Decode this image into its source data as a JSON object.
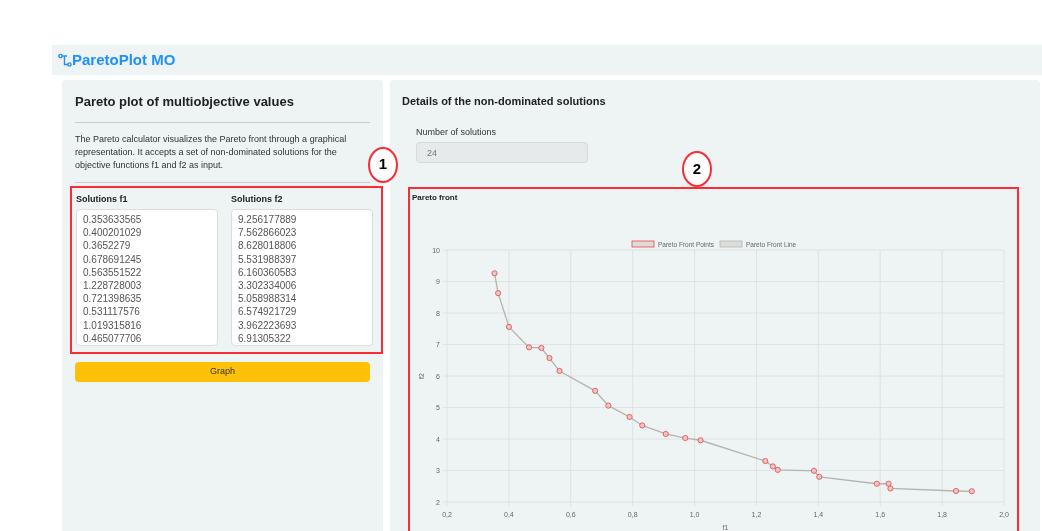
{
  "app": {
    "title": "ParetoPlot MO"
  },
  "left_panel": {
    "title": "Pareto plot of multiobjective values",
    "description": "The Pareto calculator visualizes the Pareto front through a graphical representation. It accepts a set of non-dominated solutions for the objective functions f1 and f2 as input.",
    "inputs": [
      {
        "label": "Solutions f1",
        "value": "0.353633565\n0.400201029\n0.3652279\n0.678691245\n0.563551522\n1.228728003\n0.721398635\n0.531117576\n1.019315816\n0.465077706"
      },
      {
        "label": "Solutions f2",
        "value": "9.256177889\n7.562866023\n8.628018806\n5.531988397\n6.160360583\n3.302334006\n5.058988314\n6.574921729\n3.962223693\n6.91305322"
      }
    ],
    "button": "Graph"
  },
  "right_panel": {
    "title": "Details of the non-dominated solutions",
    "count_label": "Number of solutions",
    "count_value": "24",
    "chart": {
      "title": "Pareto front",
      "chart_data": {
        "type": "scatter",
        "xlabel": "f1",
        "ylabel": "f2",
        "x": [
          0.3536,
          0.3652,
          0.4002,
          0.4651,
          0.505,
          0.5311,
          0.5636,
          0.6787,
          0.7214,
          0.79,
          0.831,
          0.907,
          0.97,
          1.0193,
          1.2287,
          1.253,
          1.269,
          1.386,
          1.403,
          1.589,
          1.627,
          1.633,
          1.845,
          1.896
        ],
        "series": [
          {
            "name": "Pareto Front Points",
            "color": "#ef4444",
            "marker": "circle",
            "values": [
              9.26,
              8.63,
              7.56,
              6.91,
              6.89,
              6.57,
              6.16,
              5.53,
              5.06,
              4.7,
              4.43,
              4.16,
              4.03,
              3.96,
              3.3,
              3.13,
              3.02,
              2.99,
              2.8,
              2.58,
              2.58,
              2.43,
              2.35,
              2.34
            ]
          },
          {
            "name": "Pareto Front Line",
            "type": "line",
            "color": "#b4b4ae",
            "values": [
              9.26,
              8.63,
              7.56,
              6.91,
              6.89,
              6.57,
              6.16,
              5.53,
              5.06,
              4.7,
              4.43,
              4.16,
              4.03,
              3.96,
              3.3,
              3.13,
              3.02,
              2.99,
              2.8,
              2.58,
              2.58,
              2.43,
              2.35,
              2.34
            ]
          }
        ],
        "grid": true,
        "legend": true,
        "xlim": [
          0.2,
          2.0
        ],
        "ylim": [
          2,
          10
        ],
        "xticks": [
          {
            "value": 0.2,
            "label": "0,2"
          },
          {
            "value": 0.4,
            "label": "0,4"
          },
          {
            "value": 0.6,
            "label": "0,6"
          },
          {
            "value": 0.8,
            "label": "0,8"
          },
          {
            "value": 1.0,
            "label": "1,0"
          },
          {
            "value": 1.2,
            "label": "1,2"
          },
          {
            "value": 1.4,
            "label": "1,4"
          },
          {
            "value": 1.6,
            "label": "1,6"
          },
          {
            "value": 1.8,
            "label": "1,8"
          },
          {
            "value": 2.0,
            "label": "2,0"
          }
        ],
        "yticks": [
          2,
          3,
          4,
          5,
          6,
          7,
          8,
          9,
          10
        ]
      }
    }
  },
  "annotations": [
    {
      "label": "1"
    },
    {
      "label": "2"
    }
  ]
}
